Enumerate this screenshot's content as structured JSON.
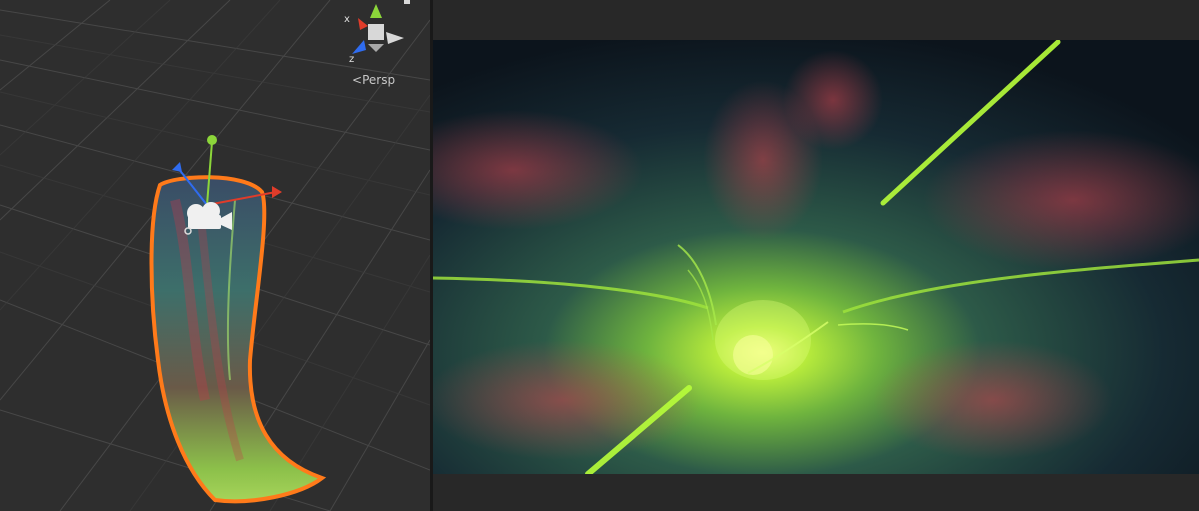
{
  "scene_view": {
    "projection_label": "Persp",
    "gizmo_axes": {
      "x": "x",
      "z": "z"
    }
  },
  "colors": {
    "scene_background": "#2e2e2e",
    "grid_line": "#4a4a4a",
    "selection_outline": "#ff7a1a",
    "axis_x": "#e03c2a",
    "axis_y": "#8cd63a",
    "axis_z": "#2f6cf0",
    "game_background": "#0e1a22",
    "glow_green": "#b8ff3a",
    "glow_red": "#c43a4a"
  },
  "icons": [
    "camera-icon",
    "scene-gizmo-icon",
    "persp-arrow-icon"
  ]
}
